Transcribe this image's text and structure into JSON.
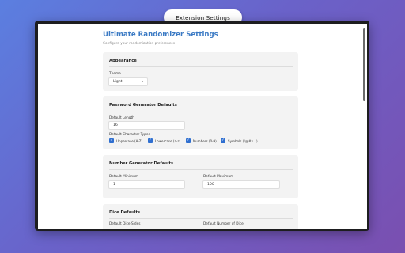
{
  "header": {
    "pill_label": "Extension Settings"
  },
  "page": {
    "title": "Ultimate Randomizer Settings",
    "subtitle": "Configure your randomization preferences"
  },
  "appearance": {
    "title": "Appearance",
    "theme_label": "Theme",
    "theme_value": "Light",
    "chevron_icon": "chevron-down-icon"
  },
  "password": {
    "title": "Password Generator Defaults",
    "length_label": "Default Length",
    "length_value": "16",
    "char_types_label": "Default Character Types",
    "options": [
      {
        "label": "Uppercase (A-Z)",
        "checked": true
      },
      {
        "label": "Lowercase (a-z)",
        "checked": true
      },
      {
        "label": "Numbers (0-9)",
        "checked": true
      },
      {
        "label": "Symbols (!@#$...)",
        "checked": true
      }
    ]
  },
  "number": {
    "title": "Number Generator Defaults",
    "min_label": "Default Minimum",
    "min_value": "1",
    "max_label": "Default Maximum",
    "max_value": "100"
  },
  "dice": {
    "title": "Dice Defaults",
    "sides_label": "Default Dice Sides",
    "count_label": "Default Number of Dice"
  },
  "colors": {
    "accent": "#3b7ac4",
    "checkbox": "#2f6fd0",
    "card_bg": "#f3f3f3"
  }
}
